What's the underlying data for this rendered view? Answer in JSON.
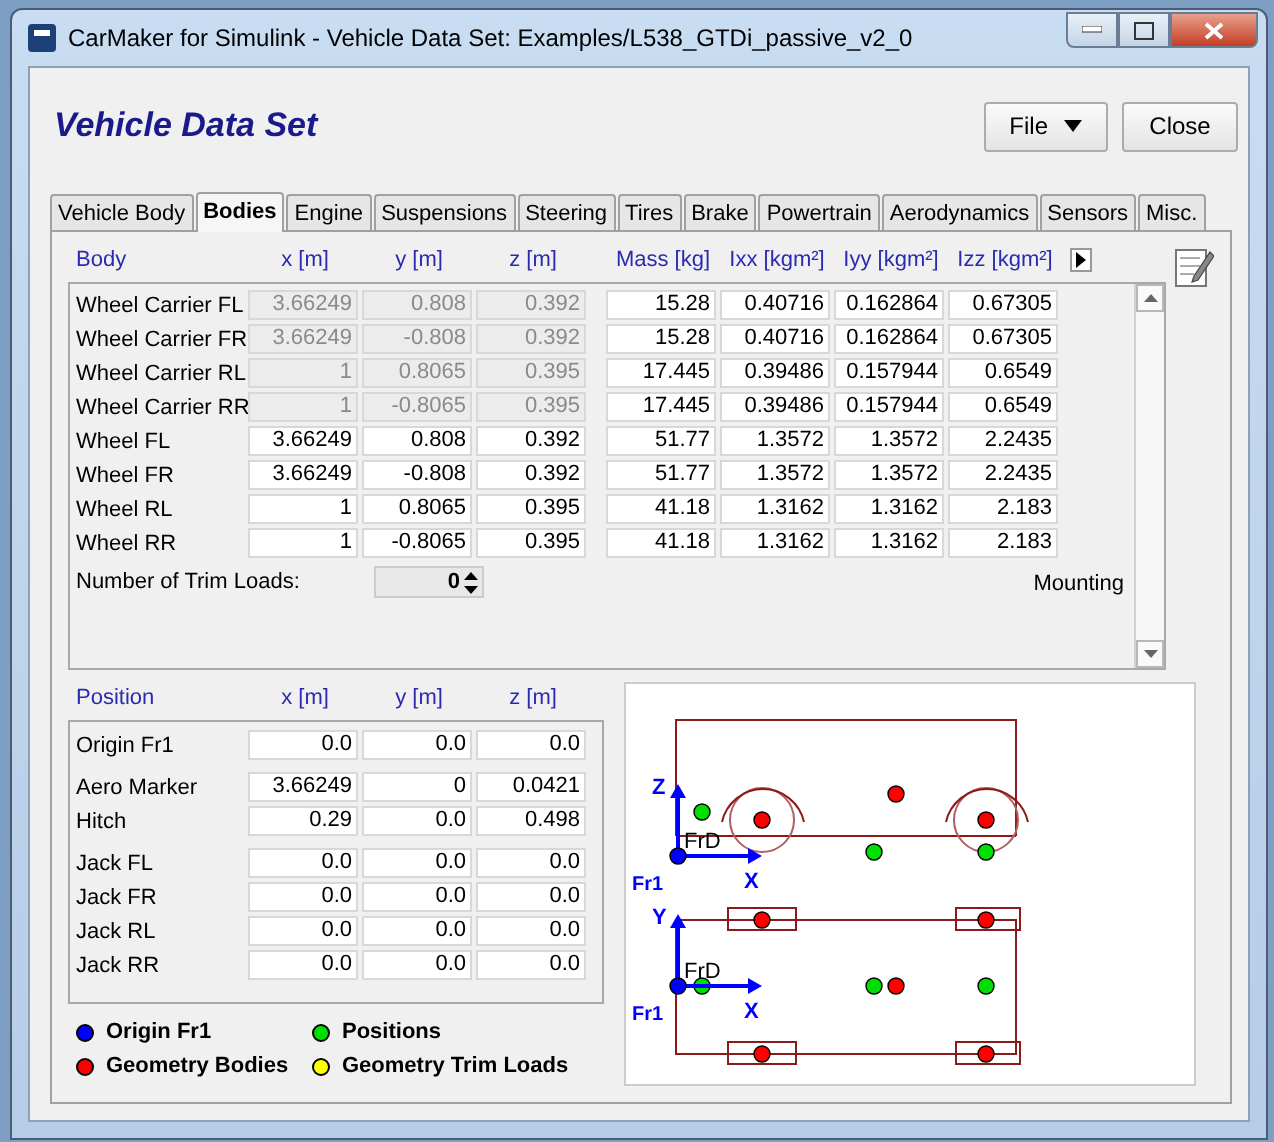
{
  "window": {
    "title": "CarMaker for Simulink - Vehicle Data Set: Examples/L538_GTDi_passive_v2_0"
  },
  "header": {
    "title": "Vehicle Data Set",
    "buttons": [
      {
        "label": "File",
        "kind": "menu"
      },
      {
        "label": "Close",
        "kind": "plain"
      }
    ]
  },
  "tabs": [
    {
      "label": "Vehicle Body",
      "selected": false
    },
    {
      "label": "Bodies",
      "selected": true
    },
    {
      "label": "Engine",
      "selected": false
    },
    {
      "label": "Suspensions",
      "selected": false
    },
    {
      "label": "Steering",
      "selected": false
    },
    {
      "label": "Tires",
      "selected": false
    },
    {
      "label": "Brake",
      "selected": false
    },
    {
      "label": "Powertrain",
      "selected": false
    },
    {
      "label": "Aerodynamics",
      "selected": false
    },
    {
      "label": "Sensors",
      "selected": false
    },
    {
      "label": "Misc.",
      "selected": false
    }
  ],
  "bodies": {
    "columns": [
      "Body",
      "x [m]",
      "y [m]",
      "z [m]",
      "Mass [kg]",
      "Ixx [kgm²]",
      "Iyy [kgm²]",
      "Izz [kgm²]"
    ],
    "rows": [
      {
        "name": "Wheel Carrier FL",
        "locked": true,
        "values": [
          "3.66249",
          "0.808",
          "0.392",
          "15.28",
          "0.40716",
          "0.162864",
          "0.67305"
        ]
      },
      {
        "name": "Wheel Carrier FR",
        "locked": true,
        "values": [
          "3.66249",
          "-0.808",
          "0.392",
          "15.28",
          "0.40716",
          "0.162864",
          "0.67305"
        ]
      },
      {
        "name": "Wheel Carrier RL",
        "locked": true,
        "values": [
          "1",
          "0.8065",
          "0.395",
          "17.445",
          "0.39486",
          "0.157944",
          "0.6549"
        ]
      },
      {
        "name": "Wheel Carrier RR",
        "locked": true,
        "values": [
          "1",
          "-0.8065",
          "0.395",
          "17.445",
          "0.39486",
          "0.157944",
          "0.6549"
        ]
      },
      {
        "name": "Wheel FL",
        "locked": false,
        "values": [
          "3.66249",
          "0.808",
          "0.392",
          "51.77",
          "1.3572",
          "1.3572",
          "2.2435"
        ]
      },
      {
        "name": "Wheel FR",
        "locked": false,
        "values": [
          "3.66249",
          "-0.808",
          "0.392",
          "51.77",
          "1.3572",
          "1.3572",
          "2.2435"
        ]
      },
      {
        "name": "Wheel RL",
        "locked": false,
        "values": [
          "1",
          "0.8065",
          "0.395",
          "41.18",
          "1.3162",
          "1.3162",
          "2.183"
        ]
      },
      {
        "name": "Wheel RR",
        "locked": false,
        "values": [
          "1",
          "-0.8065",
          "0.395",
          "41.18",
          "1.3162",
          "1.3162",
          "2.183"
        ]
      }
    ],
    "trim_loads": {
      "label": "Number of Trim Loads:",
      "value": "0"
    },
    "mounting_label": "Mounting"
  },
  "positions": {
    "columns": [
      "Position",
      "x [m]",
      "y [m]",
      "z [m]"
    ],
    "groups": [
      {
        "rows": [
          {
            "name": "Origin Fr1",
            "values": [
              "0.0",
              "0.0",
              "0.0"
            ]
          }
        ]
      },
      {
        "rows": [
          {
            "name": "Aero Marker",
            "values": [
              "3.66249",
              "0",
              "0.0421"
            ]
          },
          {
            "name": "Hitch",
            "values": [
              "0.29",
              "0.0",
              "0.498"
            ]
          }
        ]
      },
      {
        "rows": [
          {
            "name": "Jack FL",
            "values": [
              "0.0",
              "0.0",
              "0.0"
            ]
          },
          {
            "name": "Jack FR",
            "values": [
              "0.0",
              "0.0",
              "0.0"
            ]
          },
          {
            "name": "Jack RL",
            "values": [
              "0.0",
              "0.0",
              "0.0"
            ]
          },
          {
            "name": "Jack RR",
            "values": [
              "0.0",
              "0.0",
              "0.0"
            ]
          }
        ]
      }
    ]
  },
  "legend": [
    {
      "label": "Origin Fr1",
      "color": "#0000ff"
    },
    {
      "label": "Positions",
      "color": "#00e000"
    },
    {
      "label": "Geometry Bodies",
      "color": "#ff0000"
    },
    {
      "label": "Geometry Trim Loads",
      "color": "#ffff00"
    }
  ],
  "diagram": {
    "side_view": {
      "vertical_axis": "Z",
      "horizontal_axis": "X",
      "frame": "FrD",
      "origin": "Fr1"
    },
    "top_view": {
      "vertical_axis": "Y",
      "horizontal_axis": "X",
      "frame": "FrD",
      "origin": "Fr1"
    }
  }
}
